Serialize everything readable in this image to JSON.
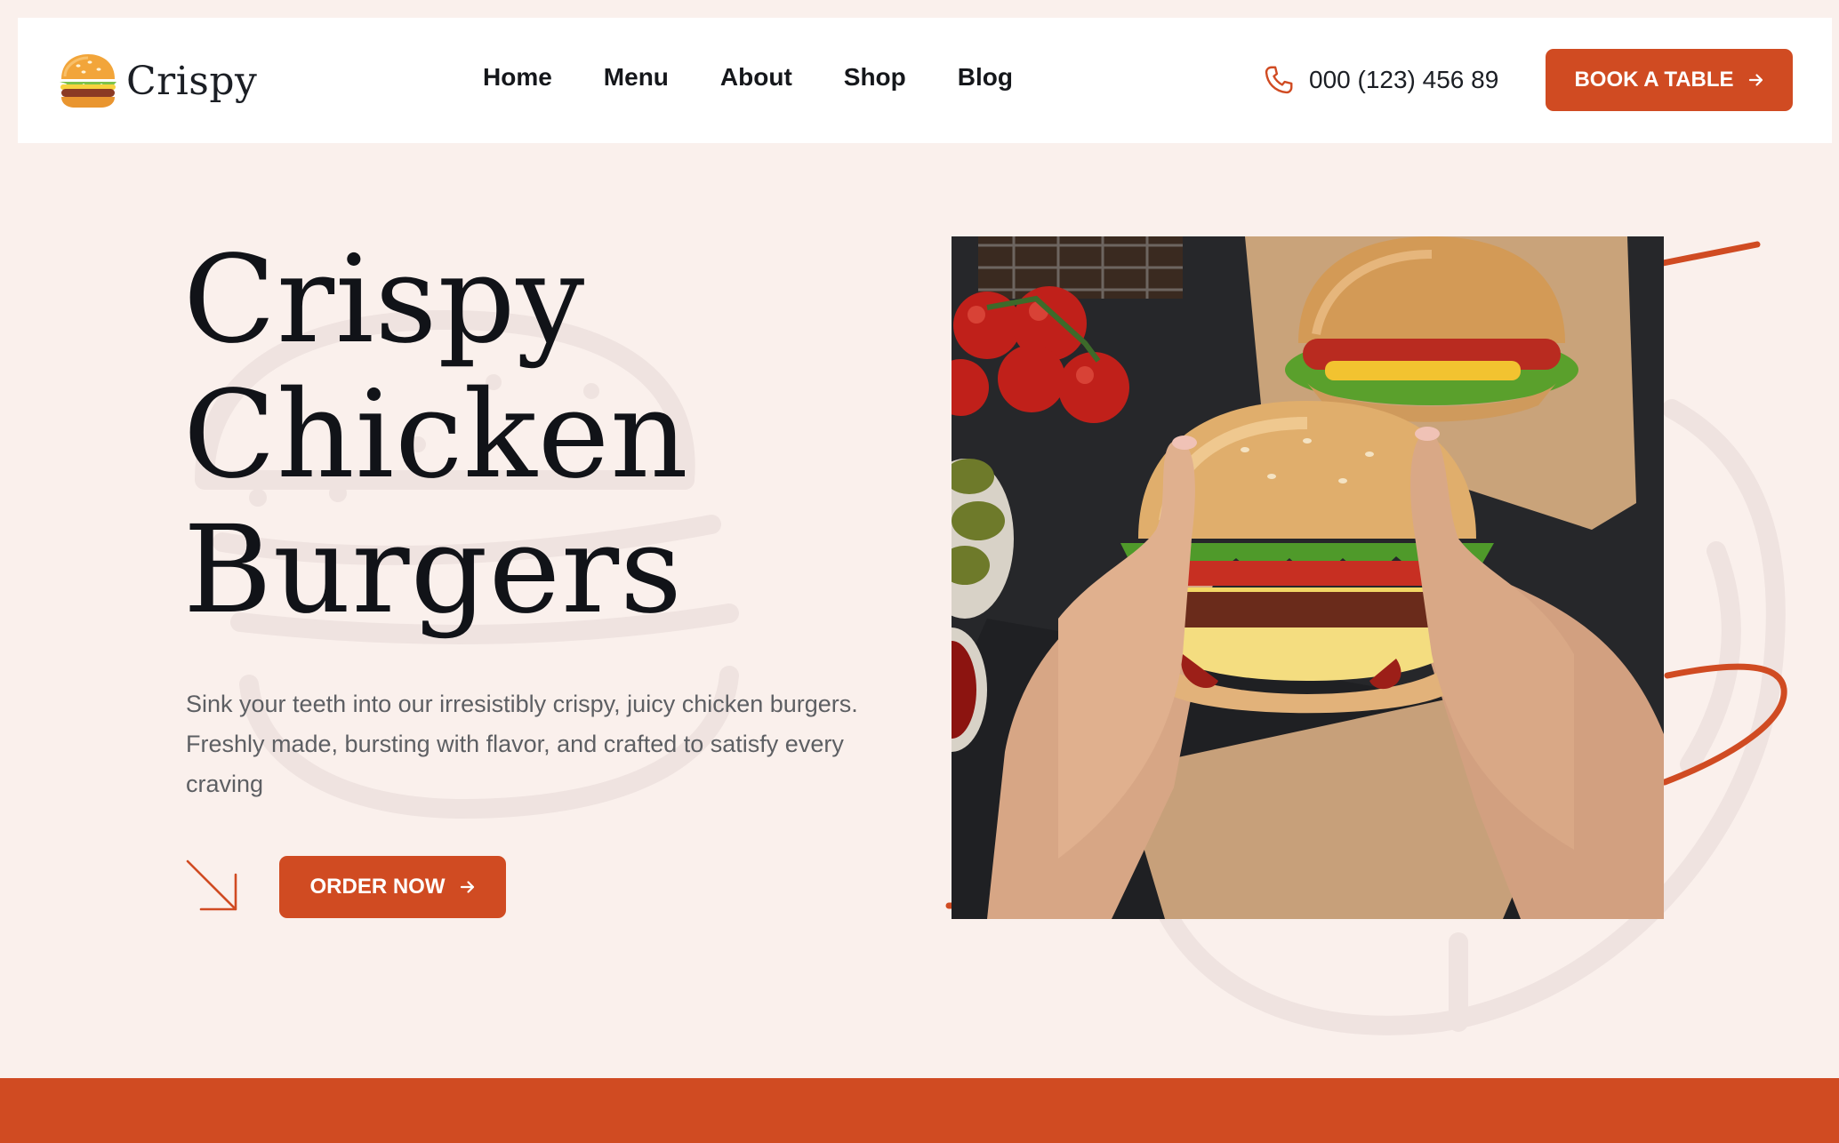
{
  "header": {
    "logo": {
      "text": "Crispy",
      "icon": "burger-icon"
    },
    "nav": [
      {
        "label": "Home"
      },
      {
        "label": "Menu"
      },
      {
        "label": "About"
      },
      {
        "label": "Shop"
      },
      {
        "label": "Blog"
      }
    ],
    "phone": {
      "number": "000 (123) 456 89",
      "icon": "phone-icon"
    },
    "book_button": {
      "label": "BOOK A TABLE",
      "icon": "arrow-right-icon"
    }
  },
  "hero": {
    "title_lines": [
      "Crispy",
      "Chicken",
      "Burgers"
    ],
    "description": "Sink your teeth into our irresistibly crispy, juicy chicken burgers. Freshly made, bursting with flavor, and crafted to satisfy every craving",
    "decor_icon": "arrow-down-right-icon",
    "order_button": {
      "label": "ORDER NOW",
      "icon": "arrow-right-icon"
    },
    "image_subject": "hands-holding-burger-photo"
  },
  "colors": {
    "accent": "#d04b22",
    "page_background": "#faf0ec",
    "header_background": "#ffffff",
    "text_dark": "#14161a",
    "text_muted": "#5d5f63"
  }
}
